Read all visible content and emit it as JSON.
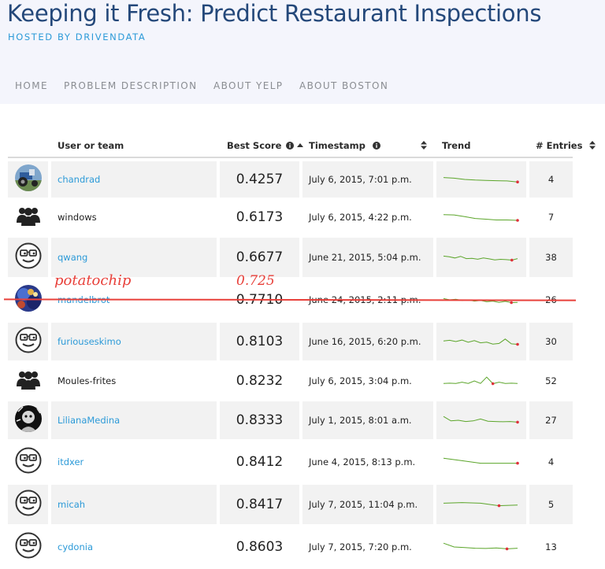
{
  "header": {
    "title": "Keeping it Fresh: Predict Restaurant Inspections",
    "subtitle": "HOSTED BY DRIVENDATA",
    "nav": [
      "HOME",
      "PROBLEM DESCRIPTION",
      "ABOUT YELP",
      "ABOUT BOSTON"
    ]
  },
  "table": {
    "columns": {
      "user": "User or team",
      "score": "Best Score",
      "timestamp": "Timestamp",
      "trend": "Trend",
      "entries": "# Entries"
    },
    "rows": [
      {
        "avatar": "photo-avatar-tractor",
        "user": "chandrad",
        "link": true,
        "score": "0.4257",
        "timestamp": "July 6, 2015, 7:01 p.m.",
        "entries": "4",
        "trend": [
          0.35,
          0.4,
          0.5,
          0.55,
          0.58,
          0.6,
          0.62,
          0.7
        ],
        "alt": true
      },
      {
        "avatar": "team-icon",
        "user": "windows",
        "link": false,
        "score": "0.6173",
        "timestamp": "July 6, 2015, 4:22 p.m.",
        "entries": "7",
        "trend": [
          0.3,
          0.32,
          0.45,
          0.6,
          0.66,
          0.72,
          0.72,
          0.75
        ],
        "alt": false
      },
      {
        "avatar": "smiley-glasses-icon",
        "user": "qwang",
        "link": true,
        "score": "0.6677",
        "timestamp": "June 21, 2015, 5:04 p.m.",
        "entries": "38",
        "trend": [
          0.4,
          0.45,
          0.55,
          0.42,
          0.6,
          0.58,
          0.65,
          0.55,
          0.62,
          0.7,
          0.66,
          0.68,
          0.72,
          0.6
        ],
        "alt": true
      },
      {
        "avatar": "photo-avatar-fractal",
        "user": "mandelbrot",
        "link": true,
        "score": "0.7710",
        "timestamp": "June 24, 2015, 2:11 p.m.",
        "entries": "26",
        "trend": [
          0.4,
          0.5,
          0.45,
          0.55,
          0.5,
          0.6,
          0.55,
          0.65,
          0.6,
          0.7,
          0.62,
          0.72,
          0.7
        ],
        "alt": false
      },
      {
        "avatar": "smiley-glasses-icon",
        "user": "furiouseskimo",
        "link": true,
        "score": "0.8103",
        "timestamp": "June 16, 2015, 6:20 p.m.",
        "entries": "30",
        "trend": [
          0.45,
          0.4,
          0.5,
          0.38,
          0.55,
          0.42,
          0.6,
          0.55,
          0.7,
          0.65,
          0.3,
          0.68,
          0.72
        ],
        "alt": true
      },
      {
        "avatar": "team-icon",
        "user": "Moules-frites",
        "link": false,
        "score": "0.8232",
        "timestamp": "July 6, 2015, 3:04 p.m.",
        "entries": "52",
        "trend": [
          0.7,
          0.68,
          0.7,
          0.6,
          0.7,
          0.5,
          0.7,
          0.2,
          0.72,
          0.6,
          0.7,
          0.68,
          0.7
        ],
        "alt": false
      },
      {
        "avatar": "photo-avatar-portrait",
        "user": "LilianaMedina",
        "link": true,
        "score": "0.8333",
        "timestamp": "July 1, 2015, 8:01 a.m.",
        "entries": "27",
        "trend": [
          0.2,
          0.55,
          0.5,
          0.6,
          0.55,
          0.4,
          0.58,
          0.6,
          0.62,
          0.6,
          0.65
        ],
        "alt": true
      },
      {
        "avatar": "smiley-glasses-icon",
        "user": "itdxer",
        "link": true,
        "score": "0.8412",
        "timestamp": "June 4, 2015, 8:13 p.m.",
        "entries": "4",
        "trend": [
          0.2,
          0.4,
          0.6,
          0.6,
          0.6
        ],
        "alt": false
      },
      {
        "avatar": "smiley-glasses-icon",
        "user": "micah",
        "link": true,
        "score": "0.8417",
        "timestamp": "July 7, 2015, 11:04 p.m.",
        "entries": "5",
        "trend": [
          0.4,
          0.35,
          0.4,
          0.6,
          0.55
        ],
        "alt": true
      },
      {
        "avatar": "smiley-glasses-icon",
        "user": "cydonia",
        "link": true,
        "score": "0.8603",
        "timestamp": "July 7, 2015, 7:20 p.m.",
        "entries": "13",
        "trend": [
          0.2,
          0.5,
          0.55,
          0.6,
          0.62,
          0.58,
          0.65,
          0.6
        ],
        "alt": false
      }
    ]
  },
  "annotations": {
    "name": "potatochip",
    "score": "0.725"
  },
  "colors": {
    "link": "#2c9ad8",
    "title": "#24487a",
    "trend": "#5ba52a",
    "trend_marker": "#e0303a",
    "annotation": "#e8403a"
  }
}
